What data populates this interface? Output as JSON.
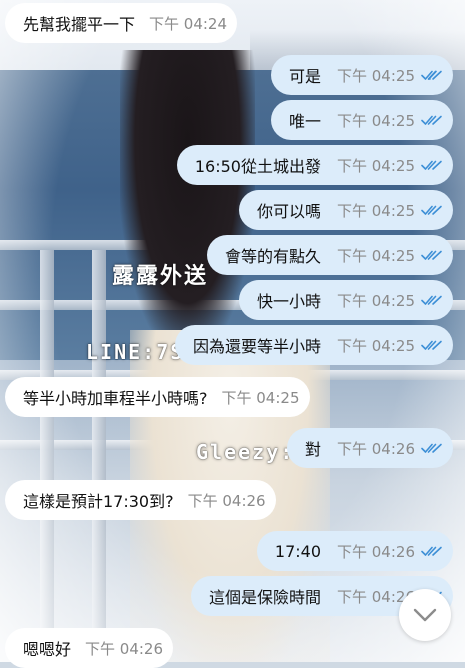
{
  "wallpaper": {
    "watermarks": [
      "露露外送",
      "LINE:7S",
      "Gleezy:"
    ]
  },
  "colors": {
    "incoming_bubble": "#ffffff",
    "outgoing_bubble": "#dcecfa",
    "read_check": "#3d8fd6",
    "timestamp": "#8a8a8a"
  },
  "messages": [
    {
      "dir": "in",
      "text": "先幫我擺平一下",
      "time": "下午 04:24"
    },
    {
      "dir": "out",
      "text": "可是",
      "time": "下午 04:25",
      "status": "read-double-check-icon"
    },
    {
      "dir": "out",
      "text": "唯一",
      "time": "下午 04:25",
      "status": "read-double-check-icon"
    },
    {
      "dir": "out",
      "text": "16:50從土城出發",
      "time": "下午 04:25",
      "status": "read-double-check-icon"
    },
    {
      "dir": "out",
      "text": "你可以嗎",
      "time": "下午 04:25",
      "status": "read-double-check-icon"
    },
    {
      "dir": "out",
      "text": "會等的有點久",
      "time": "下午 04:25",
      "status": "read-double-check-icon"
    },
    {
      "dir": "out",
      "text": "快一小時",
      "time": "下午 04:25",
      "status": "read-double-check-icon"
    },
    {
      "dir": "out",
      "text": "因為還要等半小時",
      "time": "下午 04:25",
      "status": "read-double-check-icon"
    },
    {
      "dir": "in",
      "text": "等半小時加車程半小時嗎?",
      "time": "下午 04:25"
    },
    {
      "dir": "out",
      "text": "對",
      "time": "下午 04:26",
      "status": "read-double-check-icon"
    },
    {
      "dir": "in",
      "text": "這樣是預計17:30到?",
      "time": "下午 04:26"
    },
    {
      "dir": "out",
      "text": "17:40",
      "time": "下午 04:26",
      "status": "read-double-check-icon"
    },
    {
      "dir": "out",
      "text": "這個是保險時間",
      "time": "下午 04:26",
      "status": "read-double-check-icon"
    },
    {
      "dir": "in",
      "text": "嗯嗯好",
      "time": "下午 04:26"
    }
  ],
  "scroll_down_button": {
    "icon": "chevron-down-icon"
  }
}
